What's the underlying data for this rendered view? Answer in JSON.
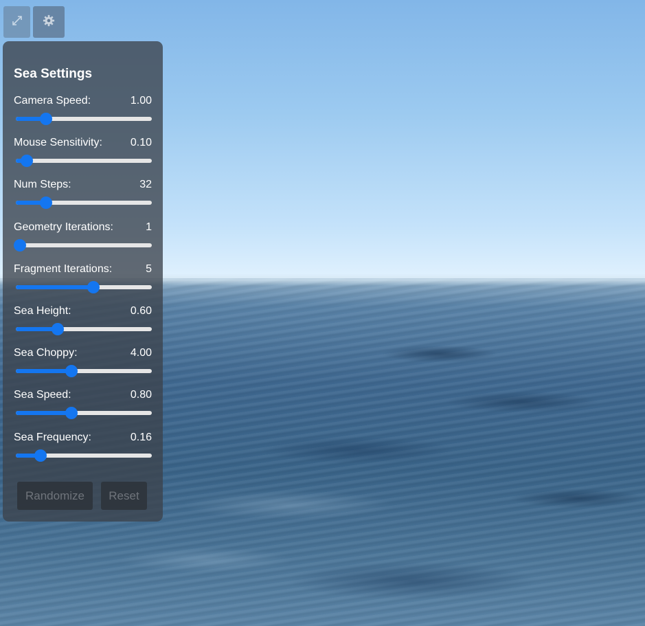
{
  "panel": {
    "title": "Sea Settings",
    "settings": [
      {
        "label": "Camera Speed:",
        "value": "1.00",
        "fraction": 0.22
      },
      {
        "label": "Mouse Sensitivity:",
        "value": "0.10",
        "fraction": 0.08
      },
      {
        "label": "Num Steps:",
        "value": "32",
        "fraction": 0.22
      },
      {
        "label": "Geometry Iterations:",
        "value": "1",
        "fraction": 0.03
      },
      {
        "label": "Fragment Iterations:",
        "value": "5",
        "fraction": 0.57
      },
      {
        "label": "Sea Height:",
        "value": "0.60",
        "fraction": 0.31
      },
      {
        "label": "Sea Choppy:",
        "value": "4.00",
        "fraction": 0.41
      },
      {
        "label": "Sea Speed:",
        "value": "0.80",
        "fraction": 0.41
      },
      {
        "label": "Sea Frequency:",
        "value": "0.16",
        "fraction": 0.18
      }
    ],
    "randomize_label": "Randomize",
    "reset_label": "Reset"
  },
  "colors": {
    "accent": "#1476f0",
    "panel_bg": "#3c424c",
    "track": "#e6e6e6"
  },
  "icons": {
    "fullscreen": "expand-arrows-icon",
    "settings": "gear-icon"
  }
}
